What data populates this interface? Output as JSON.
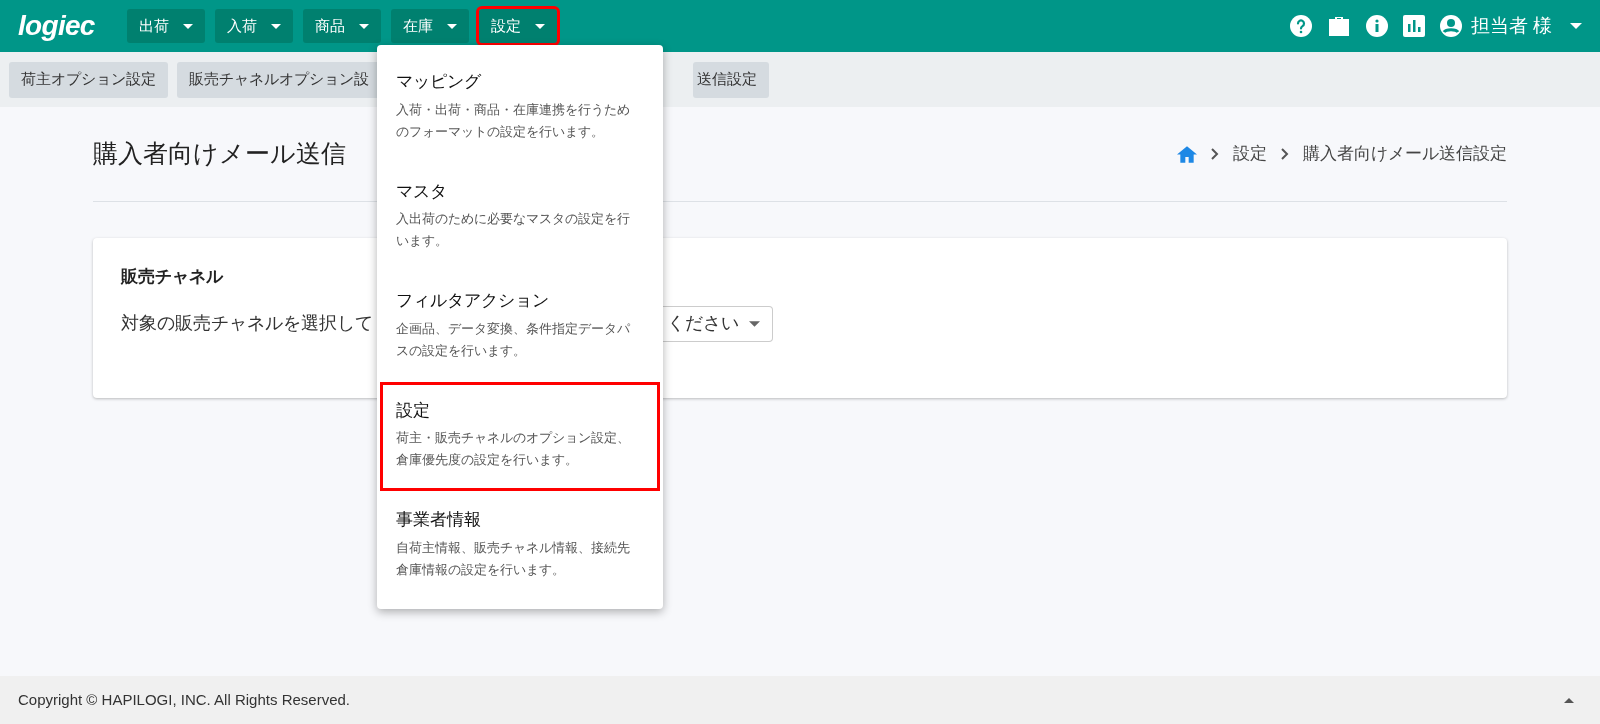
{
  "header": {
    "logo": "logiec",
    "nav": [
      {
        "label": "出荷",
        "outlined": false
      },
      {
        "label": "入荷",
        "outlined": false
      },
      {
        "label": "商品",
        "outlined": false
      },
      {
        "label": "在庫",
        "outlined": false
      },
      {
        "label": "設定",
        "outlined": true
      }
    ],
    "user": "担当者 様"
  },
  "subnav": [
    {
      "label": "荷主オプション設定"
    },
    {
      "label": "販売チャネルオプション設"
    },
    {
      "label": "送信設定"
    }
  ],
  "page": {
    "title": "購入者向けメール送信",
    "breadcrumb": [
      "設定",
      "購入者向けメール送信設定"
    ],
    "card": {
      "heading": "販売チャネル",
      "label": "対象の販売チャネルを選択して",
      "select_value": "ください"
    }
  },
  "menu": [
    {
      "title": "マッピング",
      "description": "入荷・出荷・商品・在庫連携を行うためのフォーマットの設定を行います。",
      "outlined": false
    },
    {
      "title": "マスタ",
      "description": "入出荷のために必要なマスタの設定を行います。",
      "outlined": false
    },
    {
      "title": "フィルタアクション",
      "description": "企画品、データ変換、条件指定データパスの設定を行います。",
      "outlined": false
    },
    {
      "title": "設定",
      "description": "荷主・販売チャネルのオプション設定、倉庫優先度の設定を行います。",
      "outlined": true
    },
    {
      "title": "事業者情報",
      "description": "自荷主情報、販売チャネル情報、接続先倉庫情報の設定を行います。",
      "outlined": false
    }
  ],
  "footer": {
    "copyright": "Copyright © HAPILOGI, INC. All Rights Reserved."
  }
}
